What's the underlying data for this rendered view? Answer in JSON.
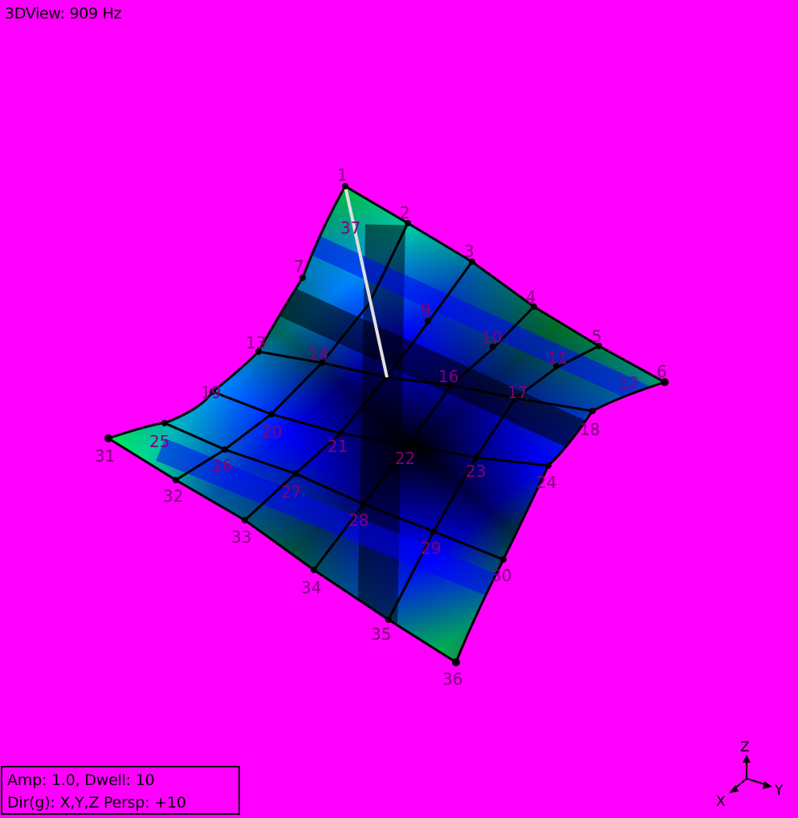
{
  "view": {
    "title": "3DView: 909 Hz"
  },
  "status": {
    "line1": "Amp: 1.0,  Dwell: 10",
    "line2": "Dir(g): X,Y,Z Persp: +10"
  },
  "axes": {
    "z": "Z",
    "y": "Y",
    "x": "X"
  },
  "colors": {
    "background": "#ff00ff",
    "label": "#80007a",
    "mesh_line": "#000000"
  },
  "mesh": {
    "nodes": [
      "1",
      "2",
      "3",
      "4",
      "5",
      "6",
      "7",
      "8",
      "9",
      "10",
      "11",
      "12",
      "13",
      "14",
      "15",
      "16",
      "17",
      "18",
      "19",
      "20",
      "21",
      "22",
      "23",
      "24",
      "25",
      "26",
      "27",
      "28",
      "29",
      "30",
      "31",
      "32",
      "33",
      "34",
      "35",
      "36",
      "37"
    ]
  }
}
